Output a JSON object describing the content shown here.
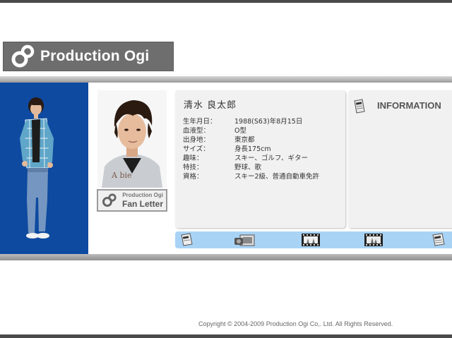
{
  "logo": {
    "text": "Production Ogi"
  },
  "profile": {
    "name": "清水 良太郎",
    "rows": [
      {
        "key": "生年月日：",
        "value": "1988(S63)年8月15日"
      },
      {
        "key": "血液型：",
        "value": "O型"
      },
      {
        "key": "出身地：",
        "value": "東京都"
      },
      {
        "key": "サイズ：",
        "value": "身長175cm"
      },
      {
        "key": "趣味：",
        "value": "スキー、ゴルフ、ギター"
      },
      {
        "key": "特技：",
        "value": "野球、歌"
      },
      {
        "key": "資格：",
        "value": "スキー2級、普通自動車免許"
      }
    ]
  },
  "fan_letter": {
    "small": "Production Ogi",
    "main": "Fan Letter"
  },
  "information": {
    "title": "INFORMATION"
  },
  "nav": {
    "items": [
      {
        "name": "info-nav-button",
        "icon": "info-card-icon"
      },
      {
        "name": "camera-nav-button",
        "icon": "camera-icon"
      },
      {
        "name": "photo-film-nav-button-1",
        "icon": "film-photo-icon"
      },
      {
        "name": "photo-film-nav-button-2",
        "icon": "film-photo-icon"
      },
      {
        "name": "info-nav-button-2",
        "icon": "info-card-icon"
      }
    ]
  },
  "footer": {
    "copyright": "Copyright © 2004-2009 Production Ogi Co,. Ltd. All Rights Reserved."
  },
  "colors": {
    "blue_panel": "#0d4aa0",
    "nav_strip": "#a9d3f5",
    "logo_bg": "#6e6e6e"
  }
}
